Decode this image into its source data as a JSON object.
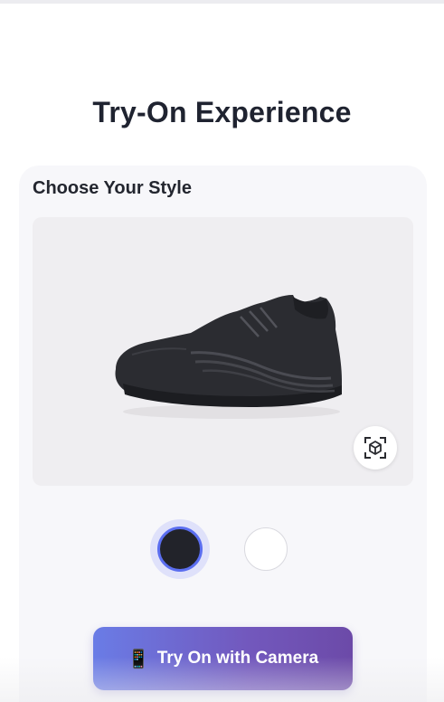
{
  "header": {
    "title": "Try-On Experience"
  },
  "style_card": {
    "section_title": "Choose Your Style",
    "viewer": {
      "product_image": "black-running-shoe",
      "ar_icon": "3d-cube-scan-icon"
    },
    "swatches": [
      {
        "name": "black",
        "color": "#22232a",
        "selected": true
      },
      {
        "name": "white",
        "color": "#ffffff",
        "selected": false
      }
    ]
  },
  "actions": {
    "camera_button_icon": "📱",
    "camera_button_label": "Try On with Camera"
  },
  "colors": {
    "accent": "#5b6ef0",
    "button_gradient_start": "#6a7ce6",
    "button_gradient_end": "#6c4aa8",
    "title_text": "#1f2330"
  }
}
